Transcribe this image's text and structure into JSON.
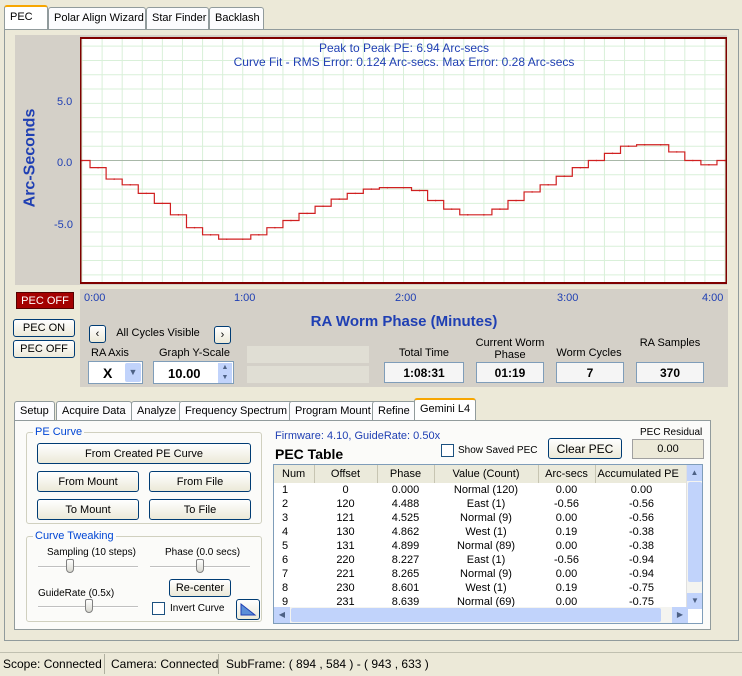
{
  "main_tabs": [
    "PEC",
    "Polar Align Wizard",
    "Star Finder",
    "Backlash"
  ],
  "chart": {
    "title1": "Peak to Peak PE: 6.94 Arc-secs",
    "title2": "Curve Fit - RMS Error: 0.124 Arc-secs.  Max Error: 0.28 Arc-secs",
    "ylabel": "Arc-Seconds",
    "yticks": [
      "5.0",
      "0.0",
      "-5.0"
    ],
    "xticks": [
      "0:00",
      "1:00",
      "2:00",
      "3:00",
      "4:00"
    ],
    "xlabel": "RA Worm Phase (Minutes)"
  },
  "chart_data": {
    "type": "line",
    "xlabel": "RA Worm Phase (Minutes)",
    "ylabel": "Arc-Seconds",
    "xlim": [
      0,
      4
    ],
    "ylim": [
      -8.5,
      8.5
    ],
    "x": [
      0,
      0.1,
      0.2,
      0.3,
      0.4,
      0.5,
      0.6,
      0.7,
      0.8,
      0.9,
      1.0,
      1.1,
      1.2,
      1.3,
      1.4,
      1.5,
      1.6,
      1.7,
      1.8,
      1.9,
      2.0,
      2.1,
      2.2,
      2.3,
      2.4,
      2.5,
      2.6,
      2.7,
      2.8,
      2.9,
      3.0,
      3.1,
      3.2,
      3.3,
      3.4,
      3.5,
      3.6,
      3.7,
      3.8,
      3.9,
      4.0
    ],
    "values": [
      0,
      -0.5,
      -1.3,
      -1.7,
      -2.3,
      -3.0,
      -3.8,
      -4.7,
      -5.2,
      -5.5,
      -5.5,
      -5.2,
      -4.7,
      -4.2,
      -3.7,
      -3.2,
      -2.7,
      -2.3,
      -2.0,
      -1.9,
      -1.9,
      -2.1,
      -2.8,
      -3.4,
      -3.8,
      -3.8,
      -3.4,
      -2.8,
      -2.2,
      -1.7,
      -1.1,
      -0.5,
      0,
      0.5,
      1.0,
      1.1,
      1.1,
      0.6,
      0,
      -0.3,
      0
    ]
  },
  "pec_off_status": "PEC OFF",
  "pec_on_button": "PEC ON",
  "pec_off_button": "PEC OFF",
  "cycles_visible": "All Cycles Visible",
  "ra_axis": {
    "label": "RA Axis",
    "value": "X"
  },
  "graph_y_scale": {
    "label": "Graph Y-Scale",
    "value": "10.00"
  },
  "total_time": {
    "label": "Total Time",
    "value": "1:08:31"
  },
  "worm_phase": {
    "label": "Current Worm Phase",
    "value": "01:19"
  },
  "worm_cycles": {
    "label": "Worm Cycles",
    "value": "7"
  },
  "ra_samples": {
    "label": "RA Samples",
    "value": "370"
  },
  "sub_tabs": [
    "Setup",
    "Acquire Data",
    "Analyze",
    "Frequency Spectrum",
    "Program Mount",
    "Refine",
    "Gemini L4"
  ],
  "pe_curve": {
    "title": "PE Curve",
    "from_created": "From Created PE Curve",
    "from_mount": "From Mount",
    "from_file": "From File",
    "to_mount": "To Mount",
    "to_file": "To File"
  },
  "curve_tweaking": {
    "title": "Curve Tweaking",
    "sampling": "Sampling (10 steps)",
    "phase": "Phase (0.0 secs)",
    "guiderate": "GuideRate (0.5x)",
    "recenter": "Re-center",
    "invert": "Invert Curve"
  },
  "firmware": "Firmware: 4.10,  GuideRate: 0.50x",
  "show_saved": "Show Saved PEC",
  "clear_pec": "Clear PEC",
  "pec_residual": {
    "label": "PEC Residual",
    "value": "0.00"
  },
  "pec_table": {
    "title": "PEC Table",
    "headers": [
      "Num",
      "Offset",
      "Phase",
      "Value (Count)",
      "Arc-secs",
      "Accumulated PE"
    ],
    "rows": [
      [
        "1",
        "0",
        "0.000",
        "Normal (120)",
        "0.00",
        "0.00"
      ],
      [
        "2",
        "120",
        "4.488",
        "East (1)",
        "-0.56",
        "-0.56"
      ],
      [
        "3",
        "121",
        "4.525",
        "Normal (9)",
        "0.00",
        "-0.56"
      ],
      [
        "4",
        "130",
        "4.862",
        "West (1)",
        "0.19",
        "-0.38"
      ],
      [
        "5",
        "131",
        "4.899",
        "Normal (89)",
        "0.00",
        "-0.38"
      ],
      [
        "6",
        "220",
        "8.227",
        "East (1)",
        "-0.56",
        "-0.94"
      ],
      [
        "7",
        "221",
        "8.265",
        "Normal (9)",
        "0.00",
        "-0.94"
      ],
      [
        "8",
        "230",
        "8.601",
        "West (1)",
        "0.19",
        "-0.75"
      ],
      [
        "9",
        "231",
        "8.639",
        "Normal (69)",
        "0.00",
        "-0.75"
      ]
    ]
  },
  "status": {
    "scope": "Scope: Connected",
    "camera": "Camera: Connected",
    "subframe": "SubFrame: ( 894 , 584 ) - ( 943 , 633 )"
  }
}
